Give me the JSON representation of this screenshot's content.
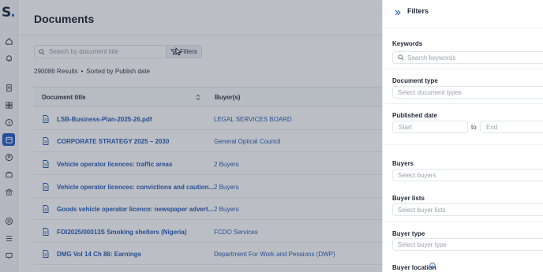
{
  "brand": {
    "logo_letter": "S",
    "logo_dot": ".",
    "accent": "#2a5fc9"
  },
  "sidebar": {
    "icons": [
      "home-icon",
      "bell-icon",
      "document-icon",
      "grid-icon",
      "dollar-icon",
      "calendar-icon",
      "user-circle-icon",
      "box-icon",
      "bank-icon",
      "target-icon",
      "list-icon",
      "monitor-icon"
    ],
    "active": "calendar-icon"
  },
  "page": {
    "title": "Documents",
    "search_placeholder": "Search by document title",
    "filters_label": "Filters",
    "results_count": "290086 Results",
    "sort_text": "Sorted by Publish date"
  },
  "table": {
    "columns": [
      "Document title",
      "Buyer(s)"
    ],
    "rows": [
      {
        "title": "LSB-Business-Plan-2025-26.pdf",
        "buyer": "LEGAL SERVICES BOARD"
      },
      {
        "title": "CORPORATE STRATEGY 2025 – 2030",
        "buyer": "General Optical Council"
      },
      {
        "title": "Vehicle operator licences: traffic areas",
        "buyer": "2 Buyers"
      },
      {
        "title": "Vehicle operator licences: convictions and caution...",
        "buyer": "2 Buyers"
      },
      {
        "title": "Goods vehicle operator licence: newspaper advert...",
        "buyer": "2 Buyers"
      },
      {
        "title": "FOI2025/00013S Smoking shelters (Nigeria)",
        "buyer": "FCDO Services"
      },
      {
        "title": "DMG Vol 14 Ch 86: Earnings",
        "buyer": "Department For Work and Pensions (DWP)"
      }
    ]
  },
  "filters_panel": {
    "title": "Filters",
    "keywords": {
      "label": "Keywords",
      "placeholder": "Search keywords"
    },
    "document_type": {
      "label": "Document type",
      "placeholder": "Select document types"
    },
    "published_date": {
      "label": "Published date",
      "start": "Start",
      "to": "to",
      "end": "End"
    },
    "buyers": {
      "label": "Buyers",
      "placeholder": "Select buyers"
    },
    "buyer_lists": {
      "label": "Buyer lists",
      "placeholder": "Select buyer lists"
    },
    "buyer_type": {
      "label": "Buyer type",
      "placeholder": "Select buyer type"
    },
    "buyer_location": {
      "label": "Buyer location"
    }
  }
}
